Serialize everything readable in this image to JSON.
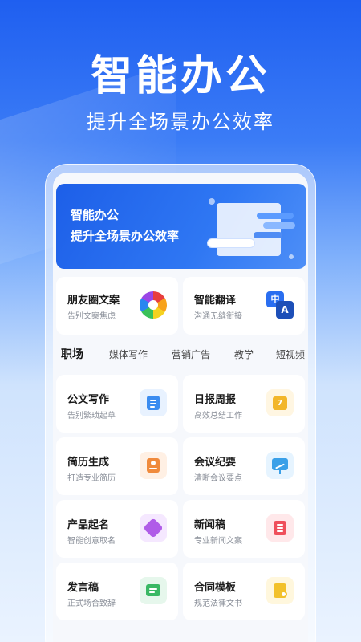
{
  "hero": {
    "title": "智能办公",
    "subtitle": "提升全场景办公效率"
  },
  "banner": {
    "line1": "智能办公",
    "line2": "提升全场景办公效率"
  },
  "features": [
    {
      "title": "朋友圈文案",
      "subtitle": "告别文案焦虑",
      "icon": "aperture-icon"
    },
    {
      "title": "智能翻译",
      "subtitle": "沟通无缝衔接",
      "icon": "translate-icon",
      "icon_text_a": "中",
      "icon_text_b": "A"
    }
  ],
  "tabs": [
    "职场",
    "媒体写作",
    "营销广告",
    "教学",
    "短视频"
  ],
  "active_tab": "职场",
  "cards": [
    {
      "title": "公文写作",
      "subtitle": "告别繁琐起草",
      "icon": "document-icon",
      "color": "#3b8cf0",
      "bg": "#e8f2ff"
    },
    {
      "title": "日报周报",
      "subtitle": "高效总结工作",
      "icon": "calendar-icon",
      "color": "#f2b62b",
      "bg": "#fff6e2",
      "icon_text": "7"
    },
    {
      "title": "简历生成",
      "subtitle": "打造专业简历",
      "icon": "resume-icon",
      "color": "#f08a3c",
      "bg": "#fff0e4"
    },
    {
      "title": "会议纪要",
      "subtitle": "清晰会议要点",
      "icon": "presentation-icon",
      "color": "#3aa0e8",
      "bg": "#e6f4ff"
    },
    {
      "title": "产品起名",
      "subtitle": "智能创意取名",
      "icon": "cube-icon",
      "color": "#b05ce8",
      "bg": "#f5e8ff"
    },
    {
      "title": "新闻稿",
      "subtitle": "专业新闻文案",
      "icon": "news-icon",
      "color": "#ef4f5b",
      "bg": "#ffe8ea"
    },
    {
      "title": "发言稿",
      "subtitle": "正式场合致辞",
      "icon": "speech-icon",
      "color": "#3ab864",
      "bg": "#e6f7ec"
    },
    {
      "title": "合同模板",
      "subtitle": "规范法律文书",
      "icon": "contract-icon",
      "color": "#f2c12b",
      "bg": "#fff7dd"
    }
  ]
}
